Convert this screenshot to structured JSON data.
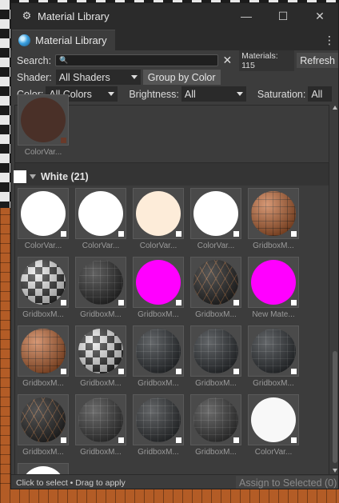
{
  "window": {
    "title": "Material Library"
  },
  "tab": {
    "label": "Material Library"
  },
  "search": {
    "label": "Search:",
    "value": "",
    "count": "Materials: 115",
    "refresh": "Refresh"
  },
  "filters": {
    "shader_label": "Shader:",
    "shader_value": "All Shaders",
    "group_by_color": "Group by Color",
    "color_label": "Color:",
    "color_value": "All Colors",
    "brightness_label": "Brightness:",
    "brightness_value": "All",
    "saturation_label": "Saturation:",
    "saturation_value": "All"
  },
  "previous_group": {
    "item_label": "ColorVar...",
    "item_color": "#4a3028"
  },
  "group": {
    "title": "White (21)",
    "swatch_color": "#ffffff"
  },
  "materials": [
    {
      "label": "ColorVar...",
      "kind": "solid",
      "color": "#ffffff"
    },
    {
      "label": "ColorVar...",
      "kind": "solid",
      "color": "#ffffff"
    },
    {
      "label": "ColorVar...",
      "kind": "solid",
      "color": "#fdecd9"
    },
    {
      "label": "ColorVar...",
      "kind": "solid",
      "color": "#ffffff"
    },
    {
      "label": "GridboxM...",
      "kind": "orange-grid",
      "color": "#c2622c"
    },
    {
      "label": "GridboxM...",
      "kind": "checker",
      "color": "#e8e8e8"
    },
    {
      "label": "GridboxM...",
      "kind": "dark-grid",
      "color": "#2c2c2c"
    },
    {
      "label": "GridboxM...",
      "kind": "solid",
      "color": "#ff00ff"
    },
    {
      "label": "GridboxM...",
      "kind": "dark-orange-grid",
      "color": "#2a2a2a"
    },
    {
      "label": "New Mate...",
      "kind": "solid",
      "color": "#ff00ff"
    },
    {
      "label": "GridboxM...",
      "kind": "orange-grid",
      "color": "#c2622c"
    },
    {
      "label": "GridboxM...",
      "kind": "checker",
      "color": "#e8e8e8"
    },
    {
      "label": "GridboxM...",
      "kind": "dark-grid",
      "color": "#2e3236"
    },
    {
      "label": "GridboxM...",
      "kind": "dark-grid",
      "color": "#2e3236"
    },
    {
      "label": "GridboxM...",
      "kind": "dark-grid",
      "color": "#2e3236"
    },
    {
      "label": "GridboxM...",
      "kind": "dark-orange-grid",
      "color": "#2a2a2a"
    },
    {
      "label": "GridboxM...",
      "kind": "dark-grid",
      "color": "#3a3a3a"
    },
    {
      "label": "GridboxM...",
      "kind": "dark-grid",
      "color": "#303336"
    },
    {
      "label": "GridboxM...",
      "kind": "dark-grid",
      "color": "#3a3a3a"
    },
    {
      "label": "ColorVar...",
      "kind": "solid",
      "color": "#f8f8f8"
    },
    {
      "label": "",
      "kind": "solid",
      "color": "#ffffff"
    }
  ],
  "status": {
    "hint": "Click to select • Drag to apply",
    "assign": "Assign to Selected (0)"
  }
}
